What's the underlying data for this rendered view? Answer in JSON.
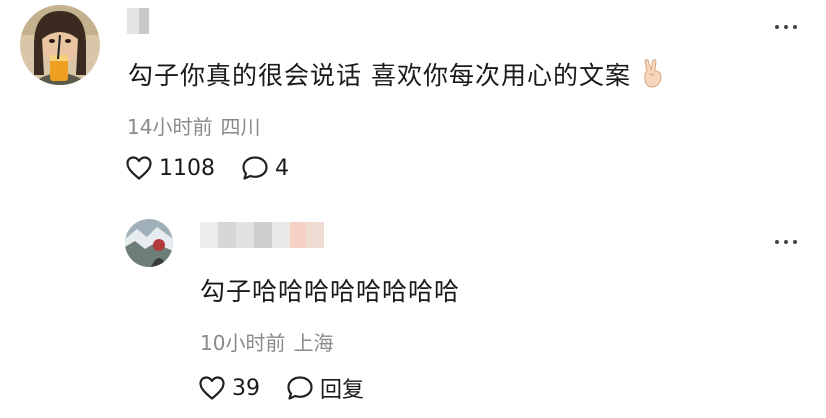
{
  "comment": {
    "text": "勾子你真的很会说话 喜欢你每次用心的文案",
    "emoji": "victory-hand-emoji",
    "time": "14小时前",
    "location": "四川",
    "likes": "1108",
    "replies": "4"
  },
  "reply": {
    "text": "勾子哈哈哈哈哈哈哈哈",
    "time": "10小时前",
    "location": "上海",
    "likes": "39",
    "reply_label": "回复"
  },
  "colors": {
    "text": "#1a1a1a",
    "meta": "#8a8a8a",
    "icon": "#222222"
  }
}
